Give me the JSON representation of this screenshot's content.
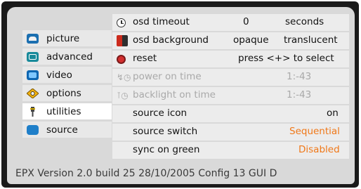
{
  "menu": [
    {
      "label": "picture",
      "icon": "picture-icon",
      "active": false
    },
    {
      "label": "advanced",
      "icon": "advanced-icon",
      "active": false
    },
    {
      "label": "video",
      "icon": "video-icon",
      "active": false
    },
    {
      "label": "options",
      "icon": "options-icon",
      "active": false
    },
    {
      "label": "utilities",
      "icon": "utilities-icon",
      "active": true
    },
    {
      "label": "source",
      "icon": "source-icon",
      "active": false
    }
  ],
  "rows": [
    {
      "label": "osd timeout",
      "value": "0",
      "unit": "seconds"
    },
    {
      "label": "osd background",
      "option1": "opaque",
      "option2": "translucent"
    },
    {
      "label": "reset",
      "value": "press <+> to select"
    },
    {
      "label": "power on time",
      "value": "1:-43",
      "disabled": true
    },
    {
      "label": "backlight on time",
      "value": "1:-43",
      "disabled": true
    },
    {
      "label": "source icon",
      "value": "on"
    },
    {
      "label": "source switch",
      "value": "Sequential"
    },
    {
      "label": "sync on green",
      "value": "Disabled"
    }
  ],
  "footer": {
    "text": "EPX  Version 2.0  build 25   28/10/2005  Config 13   GUI D"
  },
  "colors": {
    "accent_orange": "#f07818",
    "panel": "#d9d9d9",
    "frame": "#1a1a1a"
  }
}
